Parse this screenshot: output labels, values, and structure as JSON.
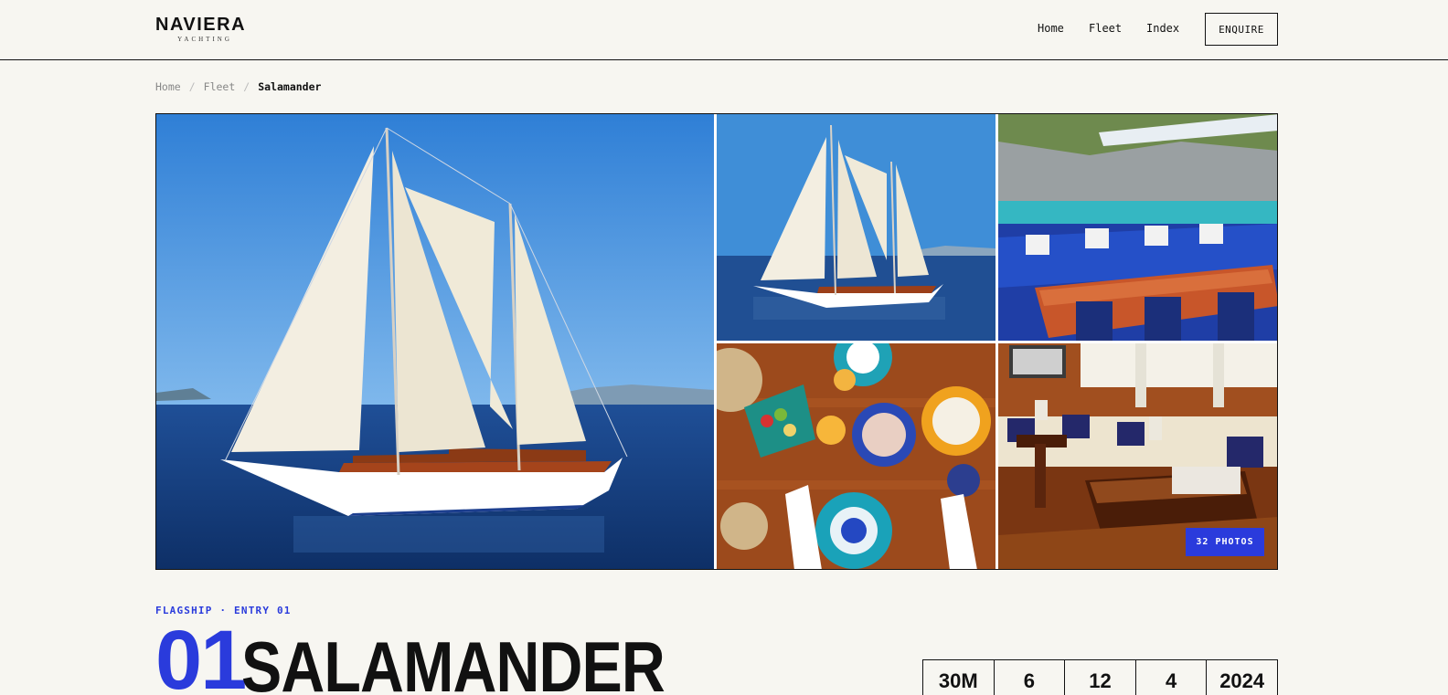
{
  "brand": {
    "name": "NAVIERA",
    "tagline": "YACHTING"
  },
  "nav": {
    "home": "Home",
    "fleet": "Fleet",
    "index": "Index",
    "enquire": "ENQUIRE"
  },
  "breadcrumb": {
    "home": "Home",
    "fleet": "Fleet",
    "current": "Salamander",
    "separator": "/"
  },
  "gallery": {
    "photos_badge": "32 PHOTOS",
    "images": [
      "gulet-under-sail-main",
      "gulet-under-sail",
      "deck-lounge-dining",
      "table-spread-food",
      "saloon-interior"
    ]
  },
  "yacht": {
    "eyebrow": "FLAGSHIP · ENTRY 01",
    "number": "01",
    "name": "SALAMANDER"
  },
  "stats": [
    "30M",
    "6",
    "12",
    "4",
    "2024"
  ],
  "colors": {
    "accent": "#2a3bdc",
    "background": "#f7f6f1",
    "ink": "#111111"
  }
}
